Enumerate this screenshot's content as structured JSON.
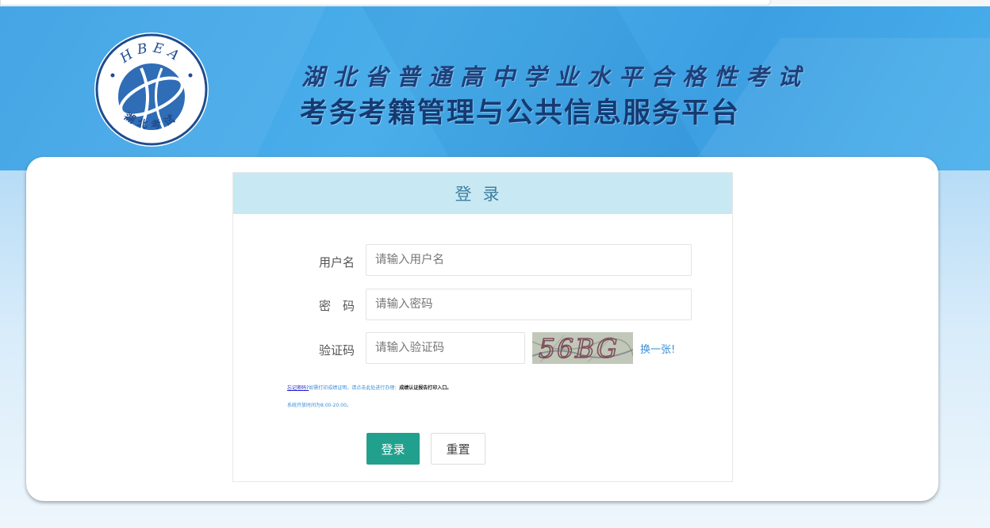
{
  "header": {
    "logo": {
      "letters": "HBEA",
      "bottom_text": "湖北考试"
    },
    "title_line1": "湖北省普通高中学业水平合格性考试",
    "title_line2": "考务考籍管理与公共信息服务平台"
  },
  "login": {
    "heading": "登录",
    "username": {
      "label": "用户名",
      "placeholder": "请输入用户名",
      "value": ""
    },
    "password": {
      "label": "密　码",
      "placeholder": "请输入密码",
      "value": ""
    },
    "captcha": {
      "label": "验证码",
      "placeholder": "请输入验证码",
      "value": "",
      "image_text": "56BG",
      "refresh_label": "换一张!"
    },
    "notice_link": "忘记密码?",
    "notice_text": "如需打印成绩证明，请点击此处进行办理：",
    "notice_bold": "成绩认证报告打印入口。",
    "hours_text": "系统开放时间为8:00-20:00。",
    "submit_label": "登录",
    "reset_label": "重置"
  },
  "colors": {
    "header_blue": "#3ea4e6",
    "title_navy": "#1f3f7a",
    "panel_head": "#c8e9f4",
    "login_button": "#22a08e",
    "link_blue": "#3a8fd8"
  }
}
